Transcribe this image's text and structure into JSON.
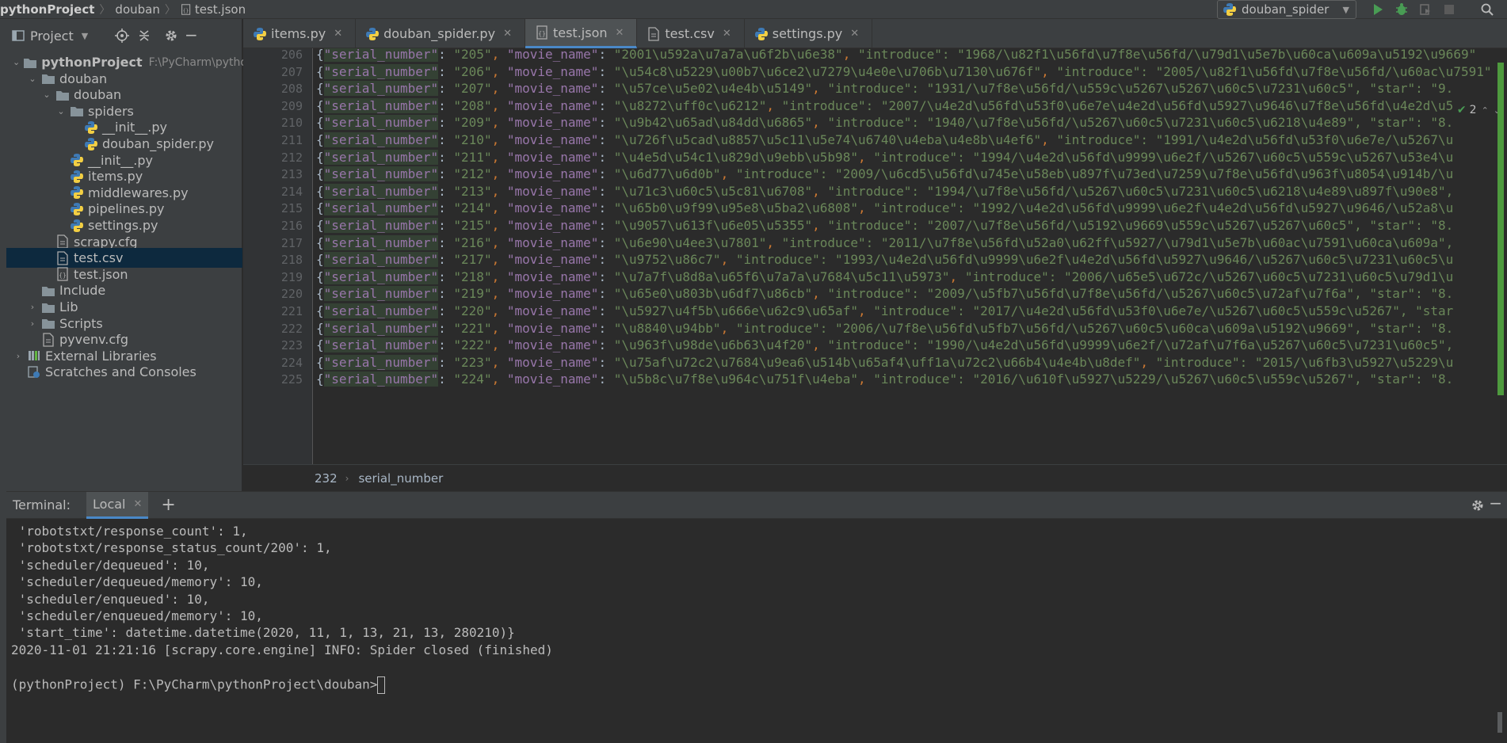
{
  "topbar": {
    "breadcrumb": [
      "pythonProject",
      "douban",
      "test.json"
    ],
    "run_config": "douban_spider"
  },
  "project_panel": {
    "title": "Project",
    "tree": [
      {
        "label": "pythonProject",
        "note": "F:\\PyCharm\\pythonProject",
        "indent": 0,
        "icon": "folder",
        "expanded": true,
        "bold": true
      },
      {
        "label": "douban",
        "indent": 1,
        "icon": "folder",
        "expanded": true
      },
      {
        "label": "douban",
        "indent": 2,
        "icon": "folder",
        "expanded": true
      },
      {
        "label": "spiders",
        "indent": 3,
        "icon": "folder",
        "expanded": true
      },
      {
        "label": "__init__.py",
        "indent": 4,
        "icon": "python"
      },
      {
        "label": "douban_spider.py",
        "indent": 4,
        "icon": "python"
      },
      {
        "label": "__init__.py",
        "indent": 3,
        "icon": "python"
      },
      {
        "label": "items.py",
        "indent": 3,
        "icon": "python"
      },
      {
        "label": "middlewares.py",
        "indent": 3,
        "icon": "python"
      },
      {
        "label": "pipelines.py",
        "indent": 3,
        "icon": "python"
      },
      {
        "label": "settings.py",
        "indent": 3,
        "icon": "python"
      },
      {
        "label": "scrapy.cfg",
        "indent": 2,
        "icon": "file"
      },
      {
        "label": "test.csv",
        "indent": 2,
        "icon": "file",
        "selected": true
      },
      {
        "label": "test.json",
        "indent": 2,
        "icon": "json"
      },
      {
        "label": "Include",
        "indent": 1,
        "icon": "folder"
      },
      {
        "label": "Lib",
        "indent": 1,
        "icon": "folder",
        "collapsed": true
      },
      {
        "label": "Scripts",
        "indent": 1,
        "icon": "folder",
        "collapsed": true
      },
      {
        "label": "pyvenv.cfg",
        "indent": 1,
        "icon": "file"
      },
      {
        "label": "External Libraries",
        "indent": 0,
        "icon": "library",
        "collapsed": true
      },
      {
        "label": "Scratches and Consoles",
        "indent": 0,
        "icon": "scratch"
      }
    ]
  },
  "tabs": [
    {
      "label": "items.py",
      "icon": "python"
    },
    {
      "label": "douban_spider.py",
      "icon": "python"
    },
    {
      "label": "test.json",
      "icon": "json",
      "active": true
    },
    {
      "label": "test.csv",
      "icon": "file"
    },
    {
      "label": "settings.py",
      "icon": "python"
    }
  ],
  "editor": {
    "inspection_count": "2",
    "lines": [
      {
        "n": "206",
        "serial": "205",
        "movie": "2001\\u592a\\u7a7a\\u6f2b\\u6e38",
        "rest": "\"introduce\": \"1968/\\u82f1\\u56fd\\u7f8e\\u56fd/\\u79d1\\u5e7b\\u60ca\\u609a\\u5192\\u9669\""
      },
      {
        "n": "207",
        "serial": "206",
        "movie": "\\u54c8\\u5229\\u00b7\\u6ce2\\u7279\\u4e0e\\u706b\\u7130\\u676f",
        "rest": "\"introduce\": \"2005/\\u82f1\\u56fd\\u7f8e\\u56fd/\\u60ac\\u7591\""
      },
      {
        "n": "208",
        "serial": "207",
        "movie": "\\u57ce\\u5e02\\u4e4b\\u5149",
        "rest": "\"introduce\": \"1931/\\u7f8e\\u56fd/\\u559c\\u5267\\u5267\\u60c5\\u7231\\u60c5\", \"star\": \"9."
      },
      {
        "n": "209",
        "serial": "208",
        "movie": "\\u8272\\uff0c\\u6212",
        "rest": "\"introduce\": \"2007/\\u4e2d\\u56fd\\u53f0\\u6e7e\\u4e2d\\u56fd\\u5927\\u9646\\u7f8e\\u56fd\\u4e2d\\u5"
      },
      {
        "n": "210",
        "serial": "209",
        "movie": "\\u9b42\\u65ad\\u84dd\\u6865",
        "rest": "\"introduce\": \"1940/\\u7f8e\\u56fd/\\u5267\\u60c5\\u7231\\u60c5\\u6218\\u4e89\", \"star\": \"8."
      },
      {
        "n": "211",
        "serial": "210",
        "movie": "\\u726f\\u5cad\\u8857\\u5c11\\u5e74\\u6740\\u4eba\\u4e8b\\u4ef6",
        "rest": "\"introduce\": \"1991/\\u4e2d\\u56fd\\u53f0\\u6e7e/\\u5267\\u"
      },
      {
        "n": "212",
        "serial": "211",
        "movie": "\\u4e5d\\u54c1\\u829d\\u9ebb\\u5b98",
        "rest": "\"introduce\": \"1994/\\u4e2d\\u56fd\\u9999\\u6e2f/\\u5267\\u60c5\\u559c\\u5267\\u53e4\\u"
      },
      {
        "n": "213",
        "serial": "212",
        "movie": "\\u6d77\\u6d0b",
        "rest": "\"introduce\": \"2009/\\u6cd5\\u56fd\\u745e\\u58eb\\u897f\\u73ed\\u7259\\u7f8e\\u56fd\\u963f\\u8054\\u914b/\\u"
      },
      {
        "n": "214",
        "serial": "213",
        "movie": "\\u71c3\\u60c5\\u5c81\\u6708",
        "rest": "\"introduce\": \"1994/\\u7f8e\\u56fd/\\u5267\\u60c5\\u7231\\u60c5\\u6218\\u4e89\\u897f\\u90e8\","
      },
      {
        "n": "215",
        "serial": "214",
        "movie": "\\u65b0\\u9f99\\u95e8\\u5ba2\\u6808",
        "rest": "\"introduce\": \"1992/\\u4e2d\\u56fd\\u9999\\u6e2f\\u4e2d\\u56fd\\u5927\\u9646/\\u52a8\\u"
      },
      {
        "n": "216",
        "serial": "215",
        "movie": "\\u9057\\u613f\\u6e05\\u5355",
        "rest": "\"introduce\": \"2007/\\u7f8e\\u56fd/\\u5192\\u9669\\u559c\\u5267\\u5267\\u60c5\", \"star\": \"8."
      },
      {
        "n": "217",
        "serial": "216",
        "movie": "\\u6e90\\u4ee3\\u7801",
        "rest": "\"introduce\": \"2011/\\u7f8e\\u56fd\\u52a0\\u62ff\\u5927/\\u79d1\\u5e7b\\u60ac\\u7591\\u60ca\\u609a\","
      },
      {
        "n": "218",
        "serial": "217",
        "movie": "\\u9752\\u86c7",
        "rest": "\"introduce\": \"1993/\\u4e2d\\u56fd\\u9999\\u6e2f\\u4e2d\\u56fd\\u5927\\u9646/\\u5267\\u60c5\\u7231\\u60c5\\u"
      },
      {
        "n": "219",
        "serial": "218",
        "movie": "\\u7a7f\\u8d8a\\u65f6\\u7a7a\\u7684\\u5c11\\u5973",
        "rest": "\"introduce\": \"2006/\\u65e5\\u672c/\\u5267\\u60c5\\u7231\\u60c5\\u79d1\\u"
      },
      {
        "n": "220",
        "serial": "219",
        "movie": "\\u65e0\\u803b\\u6df7\\u86cb",
        "rest": "\"introduce\": \"2009/\\u5fb7\\u56fd\\u7f8e\\u56fd/\\u5267\\u60c5\\u72af\\u7f6a\", \"star\": \"8."
      },
      {
        "n": "221",
        "serial": "220",
        "movie": "\\u5927\\u4f5b\\u666e\\u62c9\\u65af",
        "rest": "\"introduce\": \"2017/\\u4e2d\\u56fd\\u53f0\\u6e7e/\\u5267\\u60c5\\u559c\\u5267\", \"star"
      },
      {
        "n": "222",
        "serial": "221",
        "movie": "\\u8840\\u94bb",
        "rest": "\"introduce\": \"2006/\\u7f8e\\u56fd\\u5fb7\\u56fd/\\u5267\\u60c5\\u60ca\\u609a\\u5192\\u9669\", \"star\": \"8."
      },
      {
        "n": "223",
        "serial": "222",
        "movie": "\\u963f\\u98de\\u6b63\\u4f20",
        "rest": "\"introduce\": \"1990/\\u4e2d\\u56fd\\u9999\\u6e2f/\\u72af\\u7f6a\\u5267\\u60c5\\u7231\\u60c5\","
      },
      {
        "n": "224",
        "serial": "223",
        "movie": "\\u75af\\u72c2\\u7684\\u9ea6\\u514b\\u65af4\\uff1a\\u72c2\\u66b4\\u4e4b\\u8def",
        "rest": "\"introduce\": \"2015/\\u6fb3\\u5927\\u5229\\u"
      },
      {
        "n": "225",
        "serial": "224",
        "movie": "\\u5b8c\\u7f8e\\u964c\\u751f\\u4eba",
        "rest": "\"introduce\": \"2016/\\u610f\\u5927\\u5229/\\u5267\\u60c5\\u559c\\u5267\", \"star\": \"8."
      }
    ]
  },
  "breadcrumb_bar": {
    "line": "232",
    "key": "serial_number"
  },
  "terminal": {
    "title": "Terminal:",
    "tab": "Local",
    "lines": [
      " 'robotstxt/response_count': 1,",
      " 'robotstxt/response_status_count/200': 1,",
      " 'scheduler/dequeued': 10,",
      " 'scheduler/dequeued/memory': 10,",
      " 'scheduler/enqueued': 10,",
      " 'scheduler/enqueued/memory': 10,",
      " 'start_time': datetime.datetime(2020, 11, 1, 13, 21, 13, 280210)}",
      "2020-11-01 21:21:16 [scrapy.core.engine] INFO: Spider closed (finished)",
      "",
      "(pythonProject) F:\\PyCharm\\pythonProject\\douban>"
    ]
  },
  "colors": {
    "accent": "#4a88c7",
    "selection": "#0d293e",
    "string": "#6a8759",
    "key": "#9876aa",
    "punct": "#cc7832"
  }
}
